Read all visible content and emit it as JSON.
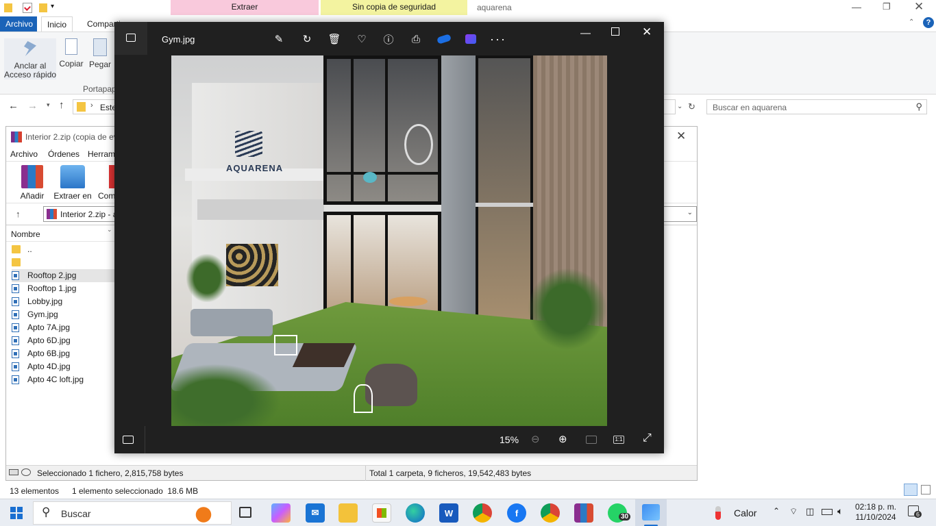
{
  "explorer": {
    "quick_access": [
      "folder",
      "properties",
      "folder",
      "dropdown"
    ],
    "ctx_tabs": [
      {
        "label": "Extraer",
        "color": "#f9c9dc"
      },
      {
        "label": "Sin copia de seguridad",
        "color": "#f3f3a0"
      }
    ],
    "window_title": "aquarena",
    "tabs": [
      "Archivo",
      "Inicio",
      "Compartir"
    ],
    "ribbon_buttons": [
      "Anclar al\nAcceso rápido",
      "Copiar",
      "Pegar"
    ],
    "group_label": "Portapapeles",
    "address_root": "Este",
    "search_placeholder": "Buscar en aquarena",
    "status_items": "13 elementos",
    "status_selected": "1 elemento seleccionado  18.6 MB"
  },
  "winrar": {
    "title": "Interior 2.zip (copia de ev",
    "menu": [
      "Archivo",
      "Órdenes",
      "Herram"
    ],
    "toolbar": [
      "Añadir",
      "Extraer en",
      "Com"
    ],
    "path": "Interior 2.zip - a",
    "column_name": "Nombre",
    "parent": "..",
    "files": [
      "Rooftop 2.jpg",
      "Rooftop 1.jpg",
      "Lobby.jpg",
      "Gym.jpg",
      "Apto 7A.jpg",
      "Apto 6D.jpg",
      "Apto 6B.jpg",
      "Apto 4D.jpg",
      "Apto 4C loft.jpg"
    ],
    "status_left": "Seleccionado 1 fichero, 2,815,758 bytes",
    "status_right": "Total 1 carpeta, 9 ficheros, 19,542,483 bytes"
  },
  "photos": {
    "title": "Gym.jpg",
    "zoom": "15%",
    "image_text": "AQUARENA"
  },
  "taskbar": {
    "search": "Buscar",
    "weather": "Calor",
    "time": "02:18 p. m.",
    "date": "11/10/2024",
    "notif_count": "6",
    "whatsapp_badge": "30"
  }
}
